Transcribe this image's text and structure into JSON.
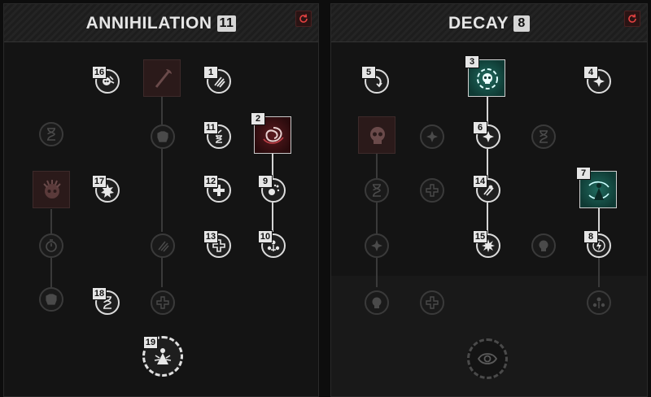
{
  "trees": [
    {
      "title": "ANNIHILATION",
      "points": "11",
      "reset_icon": "refresh-icon",
      "nodes": [
        {
          "rank": "16",
          "icon": "skull-claw-icon"
        },
        {
          "rank": "1",
          "icon": "claw-strike-icon"
        },
        {
          "rank": "11",
          "icon": "hourglass-claw-icon"
        },
        {
          "rank": "2",
          "icon": "blood-vortex-icon"
        },
        {
          "rank": "17",
          "icon": "spiked-burst-icon"
        },
        {
          "rank": "12",
          "icon": "plus-icon"
        },
        {
          "rank": "9",
          "icon": "scatter-shot-icon"
        },
        {
          "rank": "13",
          "icon": "plus-cross-icon"
        },
        {
          "rank": "10",
          "icon": "summon-burst-icon"
        },
        {
          "rank": "18",
          "icon": "hourglass-icon"
        },
        {
          "rank": "19",
          "icon": "dark-figure-ultimate-icon"
        }
      ]
    },
    {
      "title": "DECAY",
      "points": "8",
      "reset_icon": "refresh-icon",
      "nodes": [
        {
          "rank": "5",
          "icon": "curving-arrow-icon"
        },
        {
          "rank": "3",
          "icon": "skull-swirl-icon"
        },
        {
          "rank": "4",
          "icon": "sparkle-icon"
        },
        {
          "rank": "6",
          "icon": "sparkle-icon"
        },
        {
          "rank": "14",
          "icon": "claw-strike-icon"
        },
        {
          "rank": "7",
          "icon": "green-vortex-figure-icon"
        },
        {
          "rank": "15",
          "icon": "explosion-icon"
        },
        {
          "rank": "8",
          "icon": "lightning-bolt-icon"
        }
      ]
    }
  ],
  "colors": {
    "panel_bg": "#141414",
    "active_border": "#dcdcdc",
    "locked_border": "#3a3a3a",
    "red_accent": "#5a1a1e",
    "green_accent": "#1f6a5e",
    "badge_bg": "#e6e6e6"
  }
}
